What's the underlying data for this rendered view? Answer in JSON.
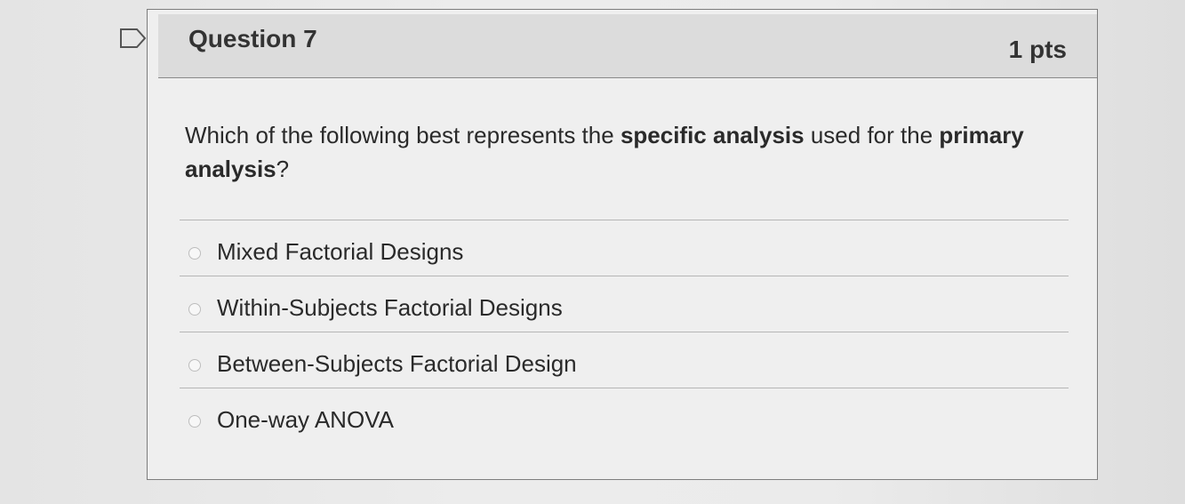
{
  "question": {
    "title": "Question 7",
    "points": "1 pts",
    "text_parts": [
      {
        "text": "Which of the following best represents the ",
        "bold": false
      },
      {
        "text": "specific analysis",
        "bold": true
      },
      {
        "text": " used for the ",
        "bold": false
      },
      {
        "text": "primary analysis",
        "bold": true
      },
      {
        "text": "?",
        "bold": false
      }
    ],
    "answers": [
      {
        "label": "Mixed Factorial Designs"
      },
      {
        "label": "Within-Subjects Factorial Designs"
      },
      {
        "label": "Between-Subjects Factorial Design"
      },
      {
        "label": "One-way ANOVA"
      }
    ]
  },
  "icons": {
    "flag": "bookmark-flag-icon",
    "radio": "radio-button-icon"
  },
  "colors": {
    "header_bg": "#dcdcdc",
    "card_bg": "#efefef",
    "border": "#7d7d7d",
    "text": "#2a2a2a"
  }
}
